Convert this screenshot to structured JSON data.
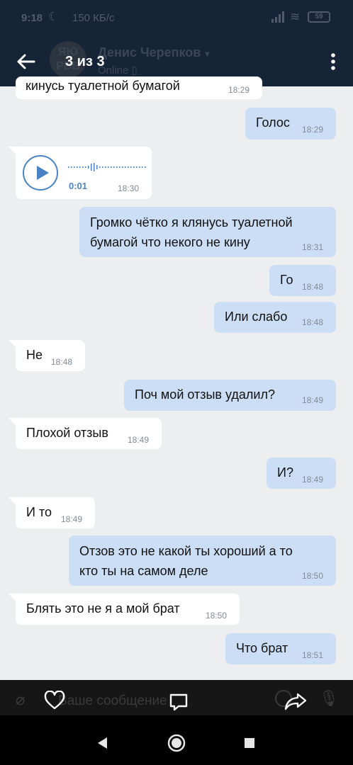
{
  "status_bar": {
    "time": "9:18",
    "speed": "150 КБ/с",
    "battery": "59"
  },
  "chat_header": {
    "avatar_text": "ЯЮ РВВ",
    "name": "Денис Черепков",
    "status": "Online"
  },
  "viewer": {
    "title": "3 из 3"
  },
  "messages": [
    {
      "dir": "in",
      "text": "кинусь туалетной бумагой",
      "time": "18:29"
    },
    {
      "dir": "out",
      "text": "Голос",
      "time": "18:29"
    },
    {
      "dir": "in",
      "type": "voice",
      "duration": "0:01",
      "time": "18:30"
    },
    {
      "dir": "out",
      "text_line1": "Громко чётко  я клянусь туалетной",
      "text_line2": "бумагой что некого не кину",
      "time": "18:31"
    },
    {
      "dir": "out",
      "text": "Го",
      "time": "18:48"
    },
    {
      "dir": "out",
      "text": "Или слабо",
      "time": "18:48"
    },
    {
      "dir": "in",
      "text": "Не",
      "time": "18:48"
    },
    {
      "dir": "out",
      "text": "Поч мой отзыв удалил?",
      "time": "18:49"
    },
    {
      "dir": "in",
      "text": "Плохой отзыв",
      "time": "18:49"
    },
    {
      "dir": "out",
      "text": "И?",
      "time": "18:49"
    },
    {
      "dir": "in",
      "text": "И то",
      "time": "18:49"
    },
    {
      "dir": "out",
      "text_line1": "Отзов  это не какой ты хороший а то",
      "text_line2": "кто ты на самом деле",
      "time": "18:50"
    },
    {
      "dir": "in",
      "text": "Блять это не я а мой брат",
      "time": "18:50"
    },
    {
      "dir": "out",
      "text": "Что брат",
      "time": "18:51"
    }
  ],
  "composer": {
    "placeholder": "Ваше сообщение"
  },
  "colors": {
    "header_bg": "#152436",
    "chat_bg": "#edeef0",
    "incoming_bubble": "#ffffff",
    "outgoing_bubble": "#ccdef5",
    "accent": "#4a83c4"
  }
}
